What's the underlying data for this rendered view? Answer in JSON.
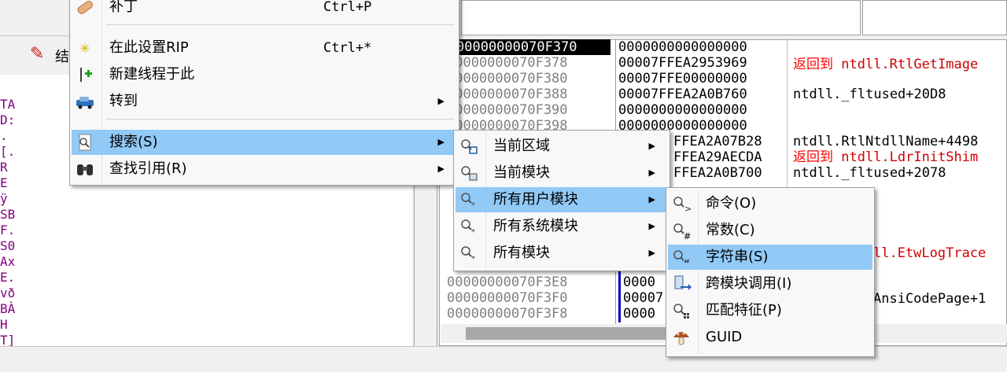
{
  "toolbar": {
    "partial_label": "结"
  },
  "stack": {
    "addresses": [
      "00000000070F370",
      "00000000070F378",
      "00000000070F380",
      "00000000070F388",
      "00000000070F390",
      "00000000070F398",
      "00000000070F3E8",
      "00000000070F3F0",
      "00000000070F3F8"
    ],
    "values": [
      "0000000000000000",
      "00007FFEA2953969",
      "00007FFE00000000",
      "00007FFEA2A0B760",
      "0000000000000000",
      "0000000000000000",
      "FFEA2A07B28",
      "FFEA29AECDA",
      "FFEA2A0B700",
      "0000",
      "00007",
      "0000"
    ],
    "comments": {
      "c1_prefix": "返回到",
      "c1_target": "ntdll.RtlGetImage",
      "c2": "ntdll._fltused+20D8",
      "c3": "ntdll.RtlNtdllName+4498",
      "c4_prefix": "返回到",
      "c4_target": "ntdll.LdrInitShim",
      "c5": "ntdll._fltused+2078",
      "c6": "ll.EtwLogTrace",
      "c7": "AnsiCodePage+1"
    }
  },
  "left_chars": [
    "TA",
    "D:",
    ".",
    "[.",
    "R",
    "E",
    "ÿ",
    "SB",
    "F.",
    "S0",
    "Ax",
    "E.",
    "vð",
    "BÀ",
    "H",
    "T]"
  ],
  "menu_main": {
    "items": [
      {
        "label": "补丁",
        "shortcut": "Ctrl+P",
        "icon": "bandage-icon"
      },
      {
        "label": "在此设置RIP",
        "shortcut": "Ctrl+*",
        "icon": "star-icon"
      },
      {
        "label": "新建线程于此",
        "icon": "new-thread-icon"
      },
      {
        "label": "转到",
        "icon": "goto-car-icon"
      },
      {
        "label": "搜索(S)",
        "icon": "search-doc-icon"
      },
      {
        "label": "查找引用(R)",
        "icon": "binoculars-icon"
      }
    ]
  },
  "menu_search": {
    "items": [
      {
        "label": "当前区域"
      },
      {
        "label": "当前模块"
      },
      {
        "label": "所有用户模块"
      },
      {
        "label": "所有系统模块"
      },
      {
        "label": "所有模块"
      }
    ]
  },
  "menu_user_modules": {
    "items": [
      {
        "label": "命令(O)"
      },
      {
        "label": "常数(C)"
      },
      {
        "label": "字符串(S)"
      },
      {
        "label": "跨模块调用(I)"
      },
      {
        "label": "匹配特征(P)"
      },
      {
        "label": "GUID"
      }
    ]
  },
  "colors": {
    "highlight": "#91c9f7",
    "return_red": "#ff0000"
  }
}
